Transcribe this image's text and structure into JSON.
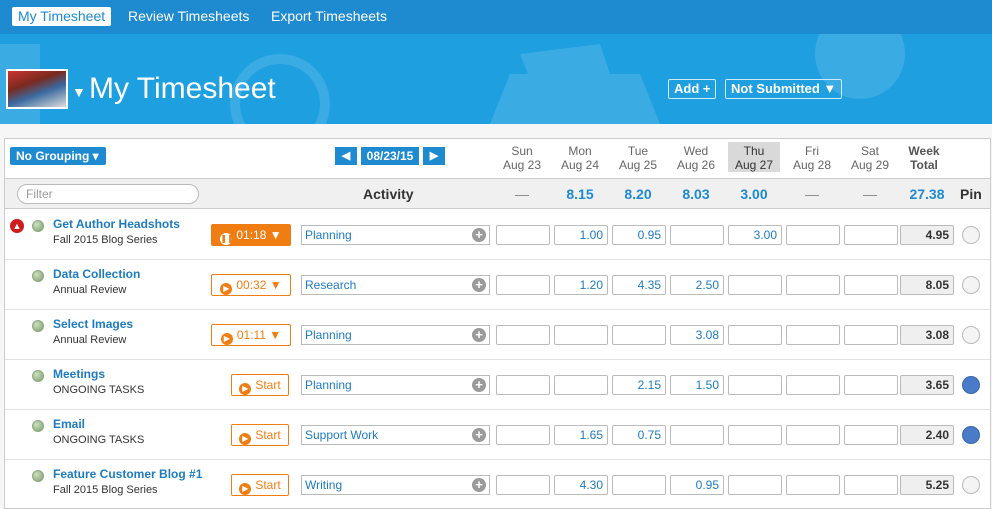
{
  "nav": {
    "tabs": [
      "My Timesheet",
      "Review Timesheets",
      "Export Timesheets"
    ],
    "active": 0
  },
  "header": {
    "title": "My Timesheet",
    "add_label": "Add +",
    "status_label": "Not Submitted ▼"
  },
  "toolbar": {
    "grouping_label": "No Grouping ▾",
    "date": "08/23/15",
    "prev": "◀",
    "next": "▶"
  },
  "days": [
    {
      "dow": "Sun",
      "date": "Aug 23",
      "total": "—"
    },
    {
      "dow": "Mon",
      "date": "Aug 24",
      "total": "8.15"
    },
    {
      "dow": "Tue",
      "date": "Aug 25",
      "total": "8.20"
    },
    {
      "dow": "Wed",
      "date": "Aug 26",
      "total": "8.03"
    },
    {
      "dow": "Thu",
      "date": "Aug 27",
      "total": "3.00"
    },
    {
      "dow": "Fri",
      "date": "Aug 28",
      "total": "—"
    },
    {
      "dow": "Sat",
      "date": "Aug 29",
      "total": "—"
    }
  ],
  "week": {
    "label1": "Week",
    "label2": "Total",
    "total": "27.38"
  },
  "summary": {
    "filter_placeholder": "Filter",
    "activity_label": "Activity",
    "pin_label": "Pin"
  },
  "rows": [
    {
      "title": "Get Author Headshots",
      "sub": "Fall 2015 Blog Series",
      "timer": "01:18 ▼",
      "activity": "Planning",
      "hours": [
        "",
        "1.00",
        "0.95",
        "",
        "3.00",
        "",
        ""
      ],
      "week": "4.95",
      "pinned": false
    },
    {
      "title": "Data Collection",
      "sub": "Annual Review",
      "timer": "00:32 ▼",
      "activity": "Research",
      "hours": [
        "",
        "1.20",
        "4.35",
        "2.50",
        "",
        "",
        ""
      ],
      "week": "8.05",
      "pinned": false
    },
    {
      "title": "Select Images",
      "sub": "Annual Review",
      "timer": "01:11 ▼",
      "activity": "Planning",
      "hours": [
        "",
        "",
        "",
        "3.08",
        "",
        "",
        ""
      ],
      "week": "3.08",
      "pinned": false
    },
    {
      "title": "Meetings",
      "sub": "ONGOING TASKS",
      "timer": "Start",
      "activity": "Planning",
      "hours": [
        "",
        "",
        "2.15",
        "1.50",
        "",
        "",
        ""
      ],
      "week": "3.65",
      "pinned": true
    },
    {
      "title": "Email",
      "sub": "ONGOING TASKS",
      "timer": "Start",
      "activity": "Support Work",
      "hours": [
        "",
        "1.65",
        "0.75",
        "",
        "",
        "",
        ""
      ],
      "week": "2.40",
      "pinned": true
    },
    {
      "title": "Feature Customer Blog #1",
      "sub": "Fall 2015 Blog Series",
      "timer": "Start",
      "activity": "Writing",
      "hours": [
        "",
        "4.30",
        "",
        "0.95",
        "",
        "",
        ""
      ],
      "week": "5.25",
      "pinned": false
    }
  ]
}
